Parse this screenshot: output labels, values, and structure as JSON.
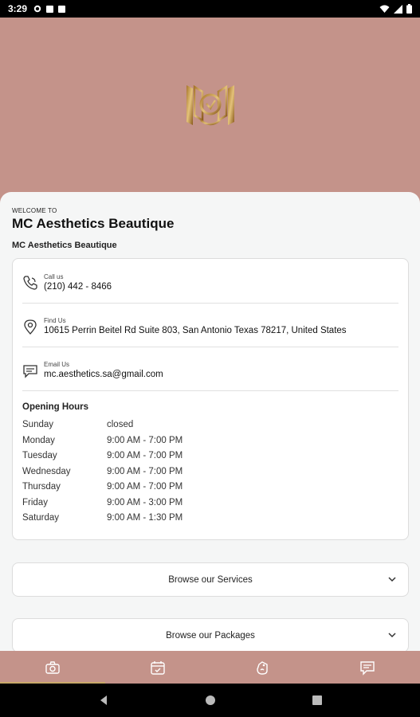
{
  "status_bar": {
    "time": "3:29"
  },
  "header": {},
  "welcome": {
    "kicker": "WELCOME TO",
    "title": "MC Aesthetics Beautique",
    "subtitle": "MC Aesthetics Beautique"
  },
  "contact": {
    "call": {
      "label": "Call us",
      "value": "(210) 442 - 8466",
      "icon": "phone-icon"
    },
    "find": {
      "label": "Find Us",
      "value": "10615 Perrin Beitel Rd Suite 803, San Antonio  Texas 78217, United States",
      "icon": "location-pin-icon"
    },
    "email": {
      "label": "Email Us",
      "value": "mc.aesthetics.sa@gmail.com",
      "icon": "message-icon"
    }
  },
  "opening_hours": {
    "title": "Opening Hours",
    "days": [
      {
        "day": "Sunday",
        "time": "closed"
      },
      {
        "day": "Monday",
        "time": "9:00 AM - 7:00 PM"
      },
      {
        "day": "Tuesday",
        "time": "9:00 AM - 7:00 PM"
      },
      {
        "day": "Wednesday",
        "time": "9:00 AM - 7:00 PM"
      },
      {
        "day": "Thursday",
        "time": "9:00 AM - 7:00 PM"
      },
      {
        "day": "Friday",
        "time": "9:00 AM - 3:00 PM"
      },
      {
        "day": "Saturday",
        "time": "9:00 AM - 1:30 PM"
      }
    ]
  },
  "sections": {
    "services": {
      "label": "Browse our Services"
    },
    "packages": {
      "label": "Browse our Packages"
    }
  },
  "tabs": [
    {
      "name": "home",
      "icon": "camera-icon",
      "active": true
    },
    {
      "name": "booking",
      "icon": "calendar-icon",
      "active": false
    },
    {
      "name": "offers",
      "icon": "tag-icon",
      "active": false
    },
    {
      "name": "messages",
      "icon": "chat-icon",
      "active": false
    }
  ],
  "colors": {
    "brand": "#c4938a",
    "accent_gold": "#c9a96a",
    "sheet_bg": "#f5f6f6"
  }
}
